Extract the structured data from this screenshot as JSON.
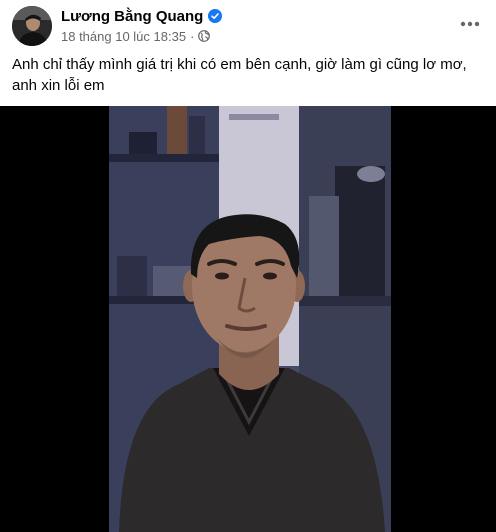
{
  "post": {
    "author_name": "Lương Bằng Quang",
    "verified_icon": "verified-badge-icon",
    "timestamp": "18 tháng 10 lúc 18:35",
    "separator": "·",
    "audience_icon": "globe-icon",
    "more_icon": "more-options-icon",
    "text": "Anh chỉ thấy mình giá trị khi có em bên cạnh, giờ làm gì cũng lơ mơ, anh xin lỗi em"
  },
  "media": {
    "type": "video",
    "background_color": "#000000"
  },
  "colors": {
    "verified": "#1877f2",
    "secondary_text": "#65676b",
    "primary_text": "#050505"
  }
}
